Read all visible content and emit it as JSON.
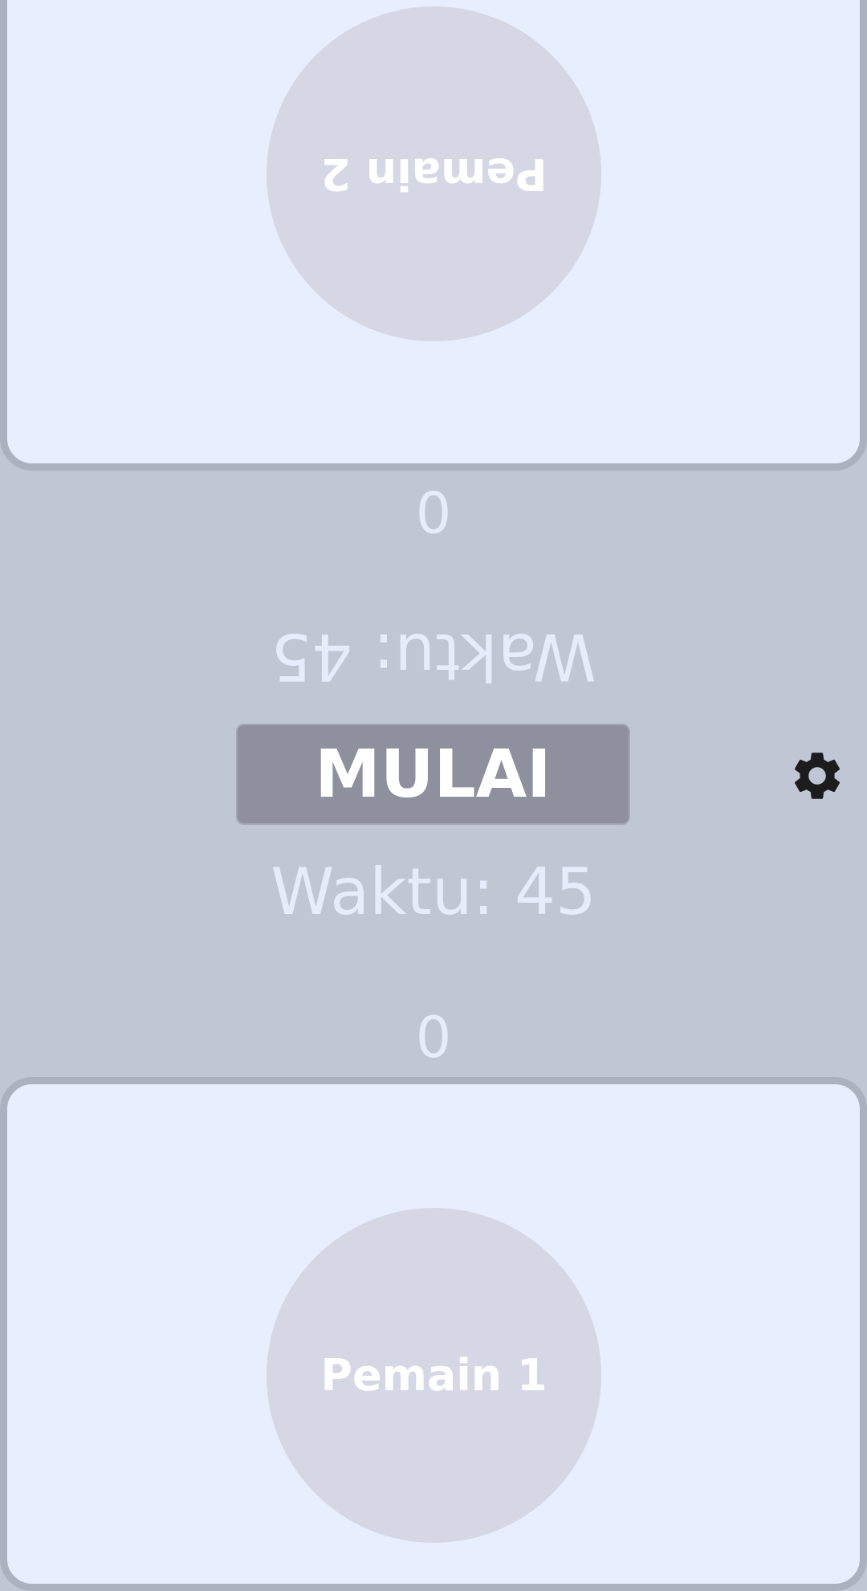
{
  "player2": {
    "name": "Pemain 2",
    "score": "0",
    "timer": "Waktu: 45"
  },
  "player1": {
    "name": "Pemain 1",
    "score": "0",
    "timer": "Waktu: 45"
  },
  "controls": {
    "start_label": "MULAI",
    "settings_icon": "gear-icon"
  },
  "colors": {
    "background": "#c0c6d4",
    "panel": "#e8eefe",
    "panel_border": "#acb1c0",
    "player_circle": "#d5d7e4",
    "button": "#8e919d",
    "text_light": "#e6ecfb",
    "icon": "#1c1c1f"
  }
}
